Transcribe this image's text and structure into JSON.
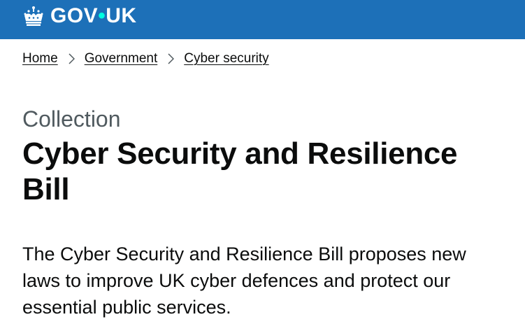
{
  "header": {
    "logo": {
      "text_left": "GOV",
      "dot": "•",
      "text_right": "UK"
    },
    "background_color": "#1d70b8",
    "logo_icon": "crown-icon"
  },
  "breadcrumbs": [
    {
      "label": "Home"
    },
    {
      "label": "Government"
    },
    {
      "label": "Cyber security"
    }
  ],
  "breadcrumb_separator_icon": "chevron-right-icon",
  "main": {
    "caption": "Collection",
    "title": "Cyber Security and Resilience Bill",
    "lead": "The Cyber Security and Resilience Bill proposes new laws to improve UK cyber defences and protect our essential public services."
  },
  "colors": {
    "text": "#0b0c0c",
    "secondary_text": "#505a5f",
    "brand_blue": "#1d70b8",
    "logo_dot": "#00ffe0"
  }
}
